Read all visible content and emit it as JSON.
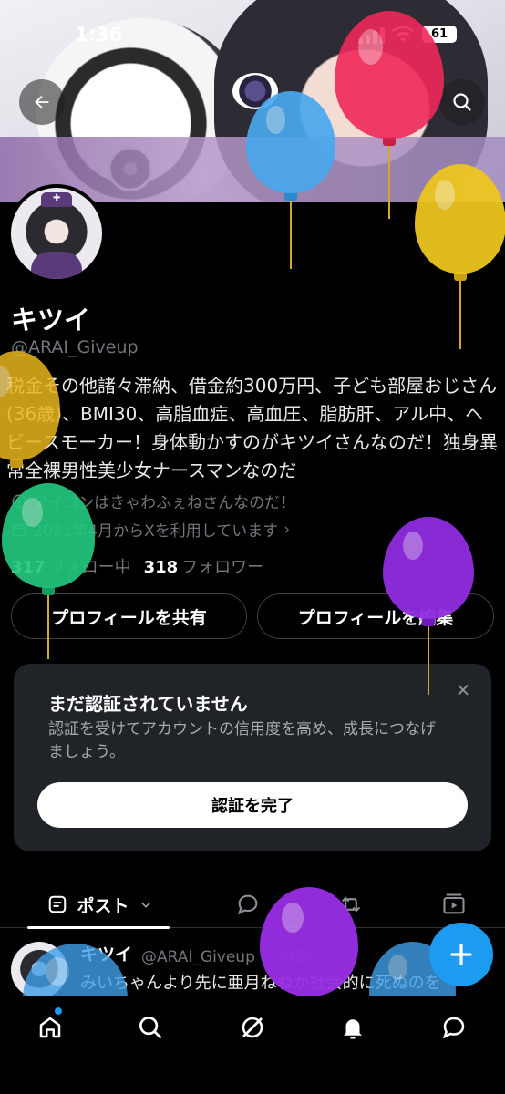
{
  "status_bar": {
    "time": "1:36",
    "battery": "61"
  },
  "profile": {
    "name": "キツイ",
    "handle": "@ARAI_Giveup",
    "bio": "税金その他諸々滞納、借金約300万円、子ども部屋おじさん(36歳)、BMI30、高脂血症、高血圧、脂肪肝、アル中、ヘビースモーカー！身体動かすのがキツイさんなのだ！独身異常全裸男性美少女ナースマンなのだ",
    "location": "アイコンはきゃわふぇねさんなのだ！",
    "joined": "2021年4月からXを利用しています",
    "following_count": "317",
    "following_label": "フォロー中",
    "followers_count": "318",
    "followers_label": "フォロワー"
  },
  "actions": {
    "share": "プロフィールを共有",
    "edit": "プロフィールを編集"
  },
  "verify_card": {
    "title": "まだ認証されていません",
    "description": "認証を受けてアカウントの信用度を高め、成長につなげましょう。",
    "cta": "認証を完了"
  },
  "tabs": {
    "posts": "ポスト"
  },
  "post": {
    "name": "キツイ",
    "handle_time": "@ARAI_Giveup · 5時間",
    "text": "みいちゃんより先に亜月ねねが社会的に死ぬのを"
  },
  "colors": {
    "accent": "#1d9bf0",
    "background": "#000000",
    "card": "#202327"
  },
  "icons": [
    "back-arrow-icon",
    "search-icon",
    "calendar-icon",
    "location-icon",
    "home-icon",
    "grok-icon",
    "bell-icon",
    "messages-icon",
    "plus-icon"
  ]
}
